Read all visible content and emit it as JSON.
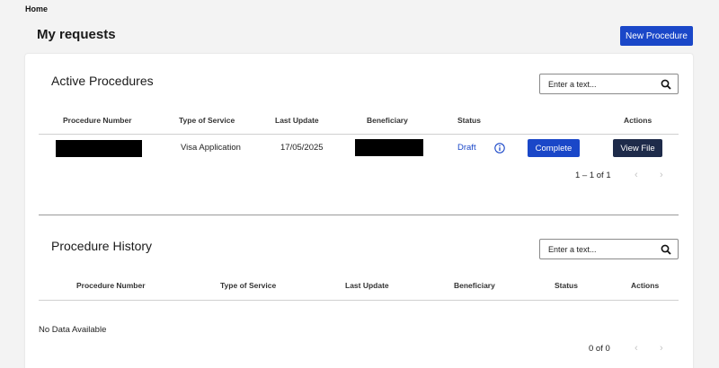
{
  "breadcrumb": {
    "home": "Home"
  },
  "header": {
    "title": "My requests",
    "new_button": "New Procedure"
  },
  "active": {
    "title": "Active Procedures",
    "search_placeholder": "Enter a text...",
    "columns": [
      "Procedure Number",
      "Type of Service",
      "Last Update",
      "Beneficiary",
      "Status",
      "Actions"
    ],
    "rows": [
      {
        "type_of_service": "Visa Application",
        "last_update": "17/05/2025",
        "status": "Draft",
        "complete_label": "Complete",
        "view_label": "View File"
      }
    ],
    "pagination": "1 – 1 of 1"
  },
  "history": {
    "title": "Procedure History",
    "search_placeholder": "Enter a text...",
    "columns": [
      "Procedure Number",
      "Type of Service",
      "Last Update",
      "Beneficiary",
      "Status",
      "Actions"
    ],
    "empty_text": "No Data Available",
    "pagination": "0 of 0"
  },
  "icons": {
    "search": "search-icon",
    "info": "info-icon",
    "prev": "chevron-left-icon",
    "next": "chevron-right-icon"
  },
  "colors": {
    "primary": "#1a47c8",
    "dark_button": "#1e2b4a",
    "status_link": "#1a47c8"
  }
}
